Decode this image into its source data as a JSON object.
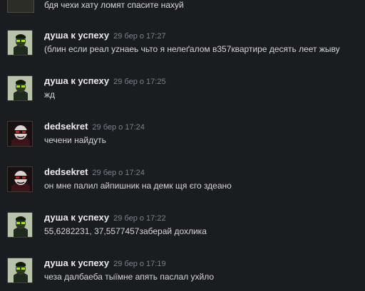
{
  "top_partial": {
    "text": "бдя чехи хату ломят спасите нахуй"
  },
  "messages": [
    {
      "author": "душа к успеху",
      "time": "29 бер о 17:27",
      "avatar_icon": "green-figure-avatar-icon",
      "text": "(блин если реал yzнаеь чьто я нелеґалом в357квартире десять леет жыву"
    },
    {
      "author": "душа к успеху",
      "time": "29 бер о 17:25",
      "avatar_icon": "green-figure-avatar-icon",
      "text": "жд"
    },
    {
      "author": "dedsekret",
      "time": "29 бер о 17:24",
      "avatar_icon": "red-masked-figure-avatar-icon",
      "text": "чечени найдуть"
    },
    {
      "author": "dedsekret",
      "time": "29 бер о 17:24",
      "avatar_icon": "red-masked-figure-avatar-icon",
      "text": "он мне палил айпишник на демк щя єго здеано"
    },
    {
      "author": "душа к успеху",
      "time": "29 бер о 17:22",
      "avatar_icon": "green-figure-avatar-icon",
      "text": "55,6282231, 37,5577457заберай дохлика"
    },
    {
      "author": "душа к успеху",
      "time": "29 бер о 17:19",
      "avatar_icon": "green-figure-avatar-icon",
      "text": "чеза далбаеба тыїмне апять паслал ухйло"
    }
  ],
  "colors": {
    "background": "#1b1c20",
    "author": "#ececec",
    "timestamp": "#7d8187",
    "message_text": "#d6d6d6"
  }
}
